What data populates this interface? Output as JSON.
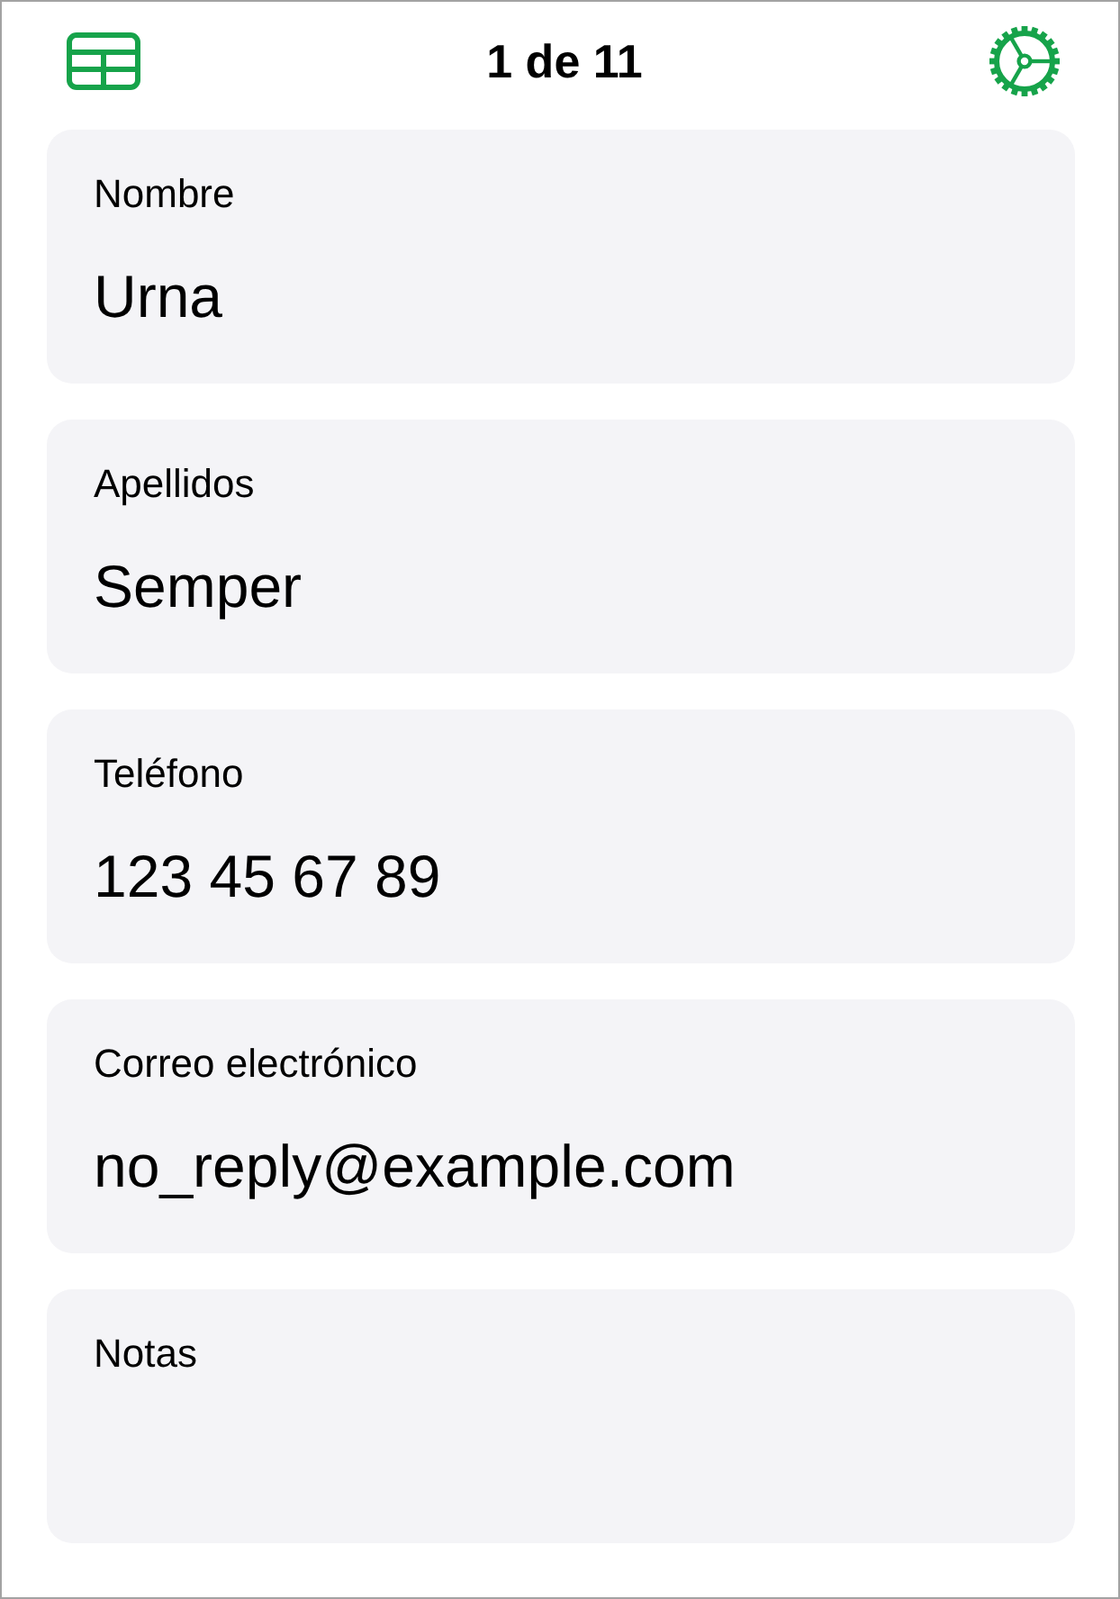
{
  "header": {
    "title": "1 de 11"
  },
  "fields": [
    {
      "label": "Nombre",
      "value": "Urna"
    },
    {
      "label": "Apellidos",
      "value": "Semper"
    },
    {
      "label": "Teléfono",
      "value": "123 45 67 89"
    },
    {
      "label": "Correo electrónico",
      "value": "no_reply@example.com"
    },
    {
      "label": "Notas"
    }
  ]
}
